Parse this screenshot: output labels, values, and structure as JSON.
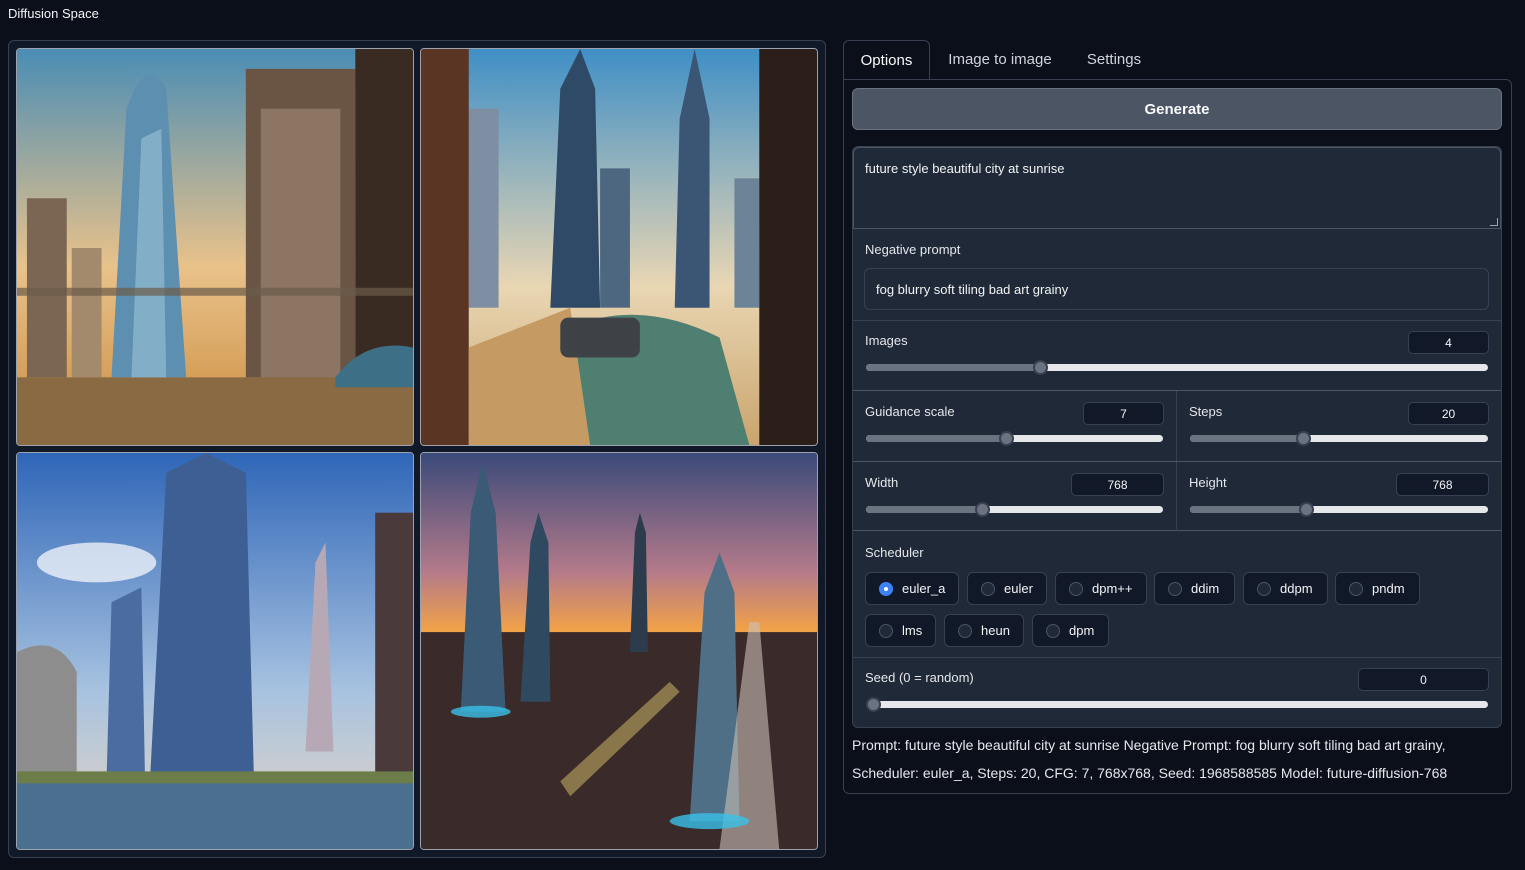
{
  "app": {
    "title": "Diffusion Space"
  },
  "tabs": [
    {
      "label": "Options",
      "active": true
    },
    {
      "label": "Image to image",
      "active": false
    },
    {
      "label": "Settings",
      "active": false
    }
  ],
  "generate": {
    "label": "Generate"
  },
  "prompt": {
    "value": "future style beautiful city at sunrise"
  },
  "negative_prompt": {
    "label": "Negative prompt",
    "value": "fog blurry soft tiling bad art grainy"
  },
  "images": {
    "label": "Images",
    "value": "4",
    "fraction": 0.28
  },
  "guidance": {
    "label": "Guidance scale",
    "value": "7",
    "fraction": 0.47
  },
  "steps": {
    "label": "Steps",
    "value": "20",
    "fraction": 0.38
  },
  "width": {
    "label": "Width",
    "value": "768",
    "fraction": 0.39
  },
  "height": {
    "label": "Height",
    "value": "768",
    "fraction": 0.39
  },
  "scheduler": {
    "label": "Scheduler",
    "selected": "euler_a",
    "options": [
      "euler_a",
      "euler",
      "dpm++",
      "ddim",
      "ddpm",
      "pndm",
      "lms",
      "heun",
      "dpm"
    ]
  },
  "seed": {
    "label": "Seed (0 = random)",
    "value": "0",
    "fraction": 0.0
  },
  "info": {
    "line1": "Prompt: future style beautiful city at sunrise Negative Prompt: fog blurry soft tiling bad art grainy,",
    "line2": "Scheduler: euler_a, Steps: 20, CFG: 7, 768x768, Seed: 1968588585 Model: future-diffusion-768"
  }
}
